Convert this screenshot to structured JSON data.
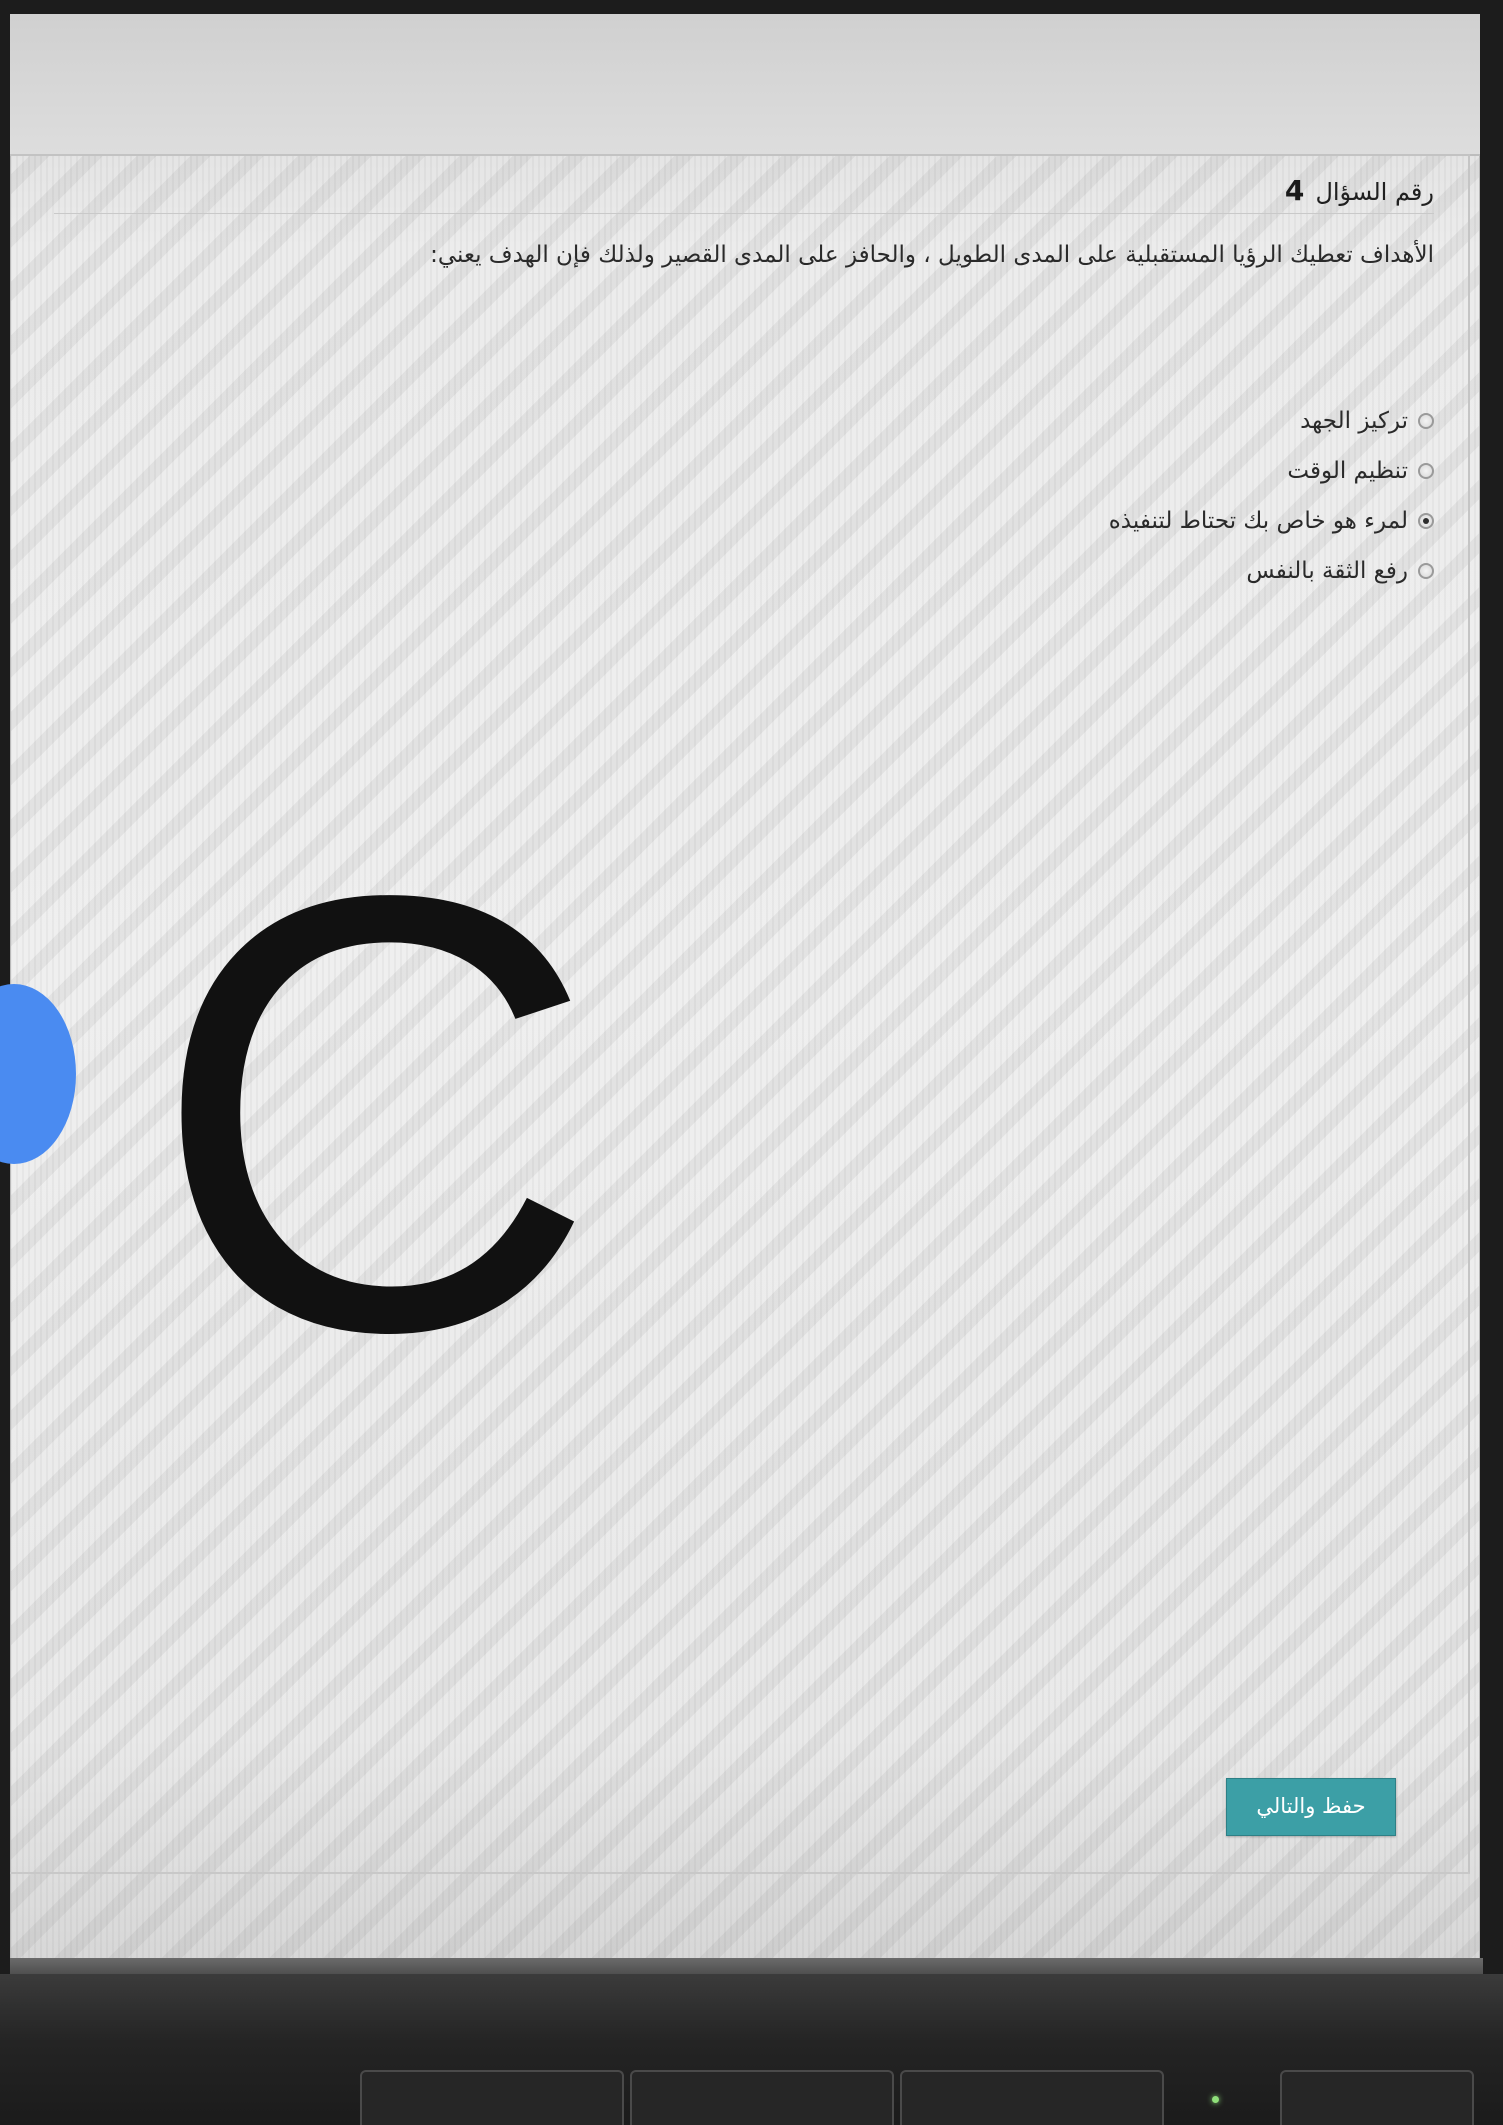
{
  "question": {
    "number_label": "رقم السؤال",
    "number": "4",
    "text": "الأهداف تعطيك الرؤيا المستقبلية على المدى الطويل ، والحافز على المدى القصير ولذلك فإن الهدف يعني:"
  },
  "options": [
    {
      "label": "تركيز الجهد",
      "selected": false
    },
    {
      "label": "تنظيم الوقت",
      "selected": false
    },
    {
      "label": "لمرء هو خاص بك تحتاط لتنفيذه",
      "selected": true
    },
    {
      "label": "رفع الثقة بالنفس",
      "selected": false
    }
  ],
  "actions": {
    "save_next_label": "حفظ والتالي"
  },
  "overlay": {
    "letter": "C",
    "dot_color": "#4a8bf1"
  },
  "colors": {
    "button_bg": "#3c9fa6",
    "page_bg": "#ececec"
  }
}
